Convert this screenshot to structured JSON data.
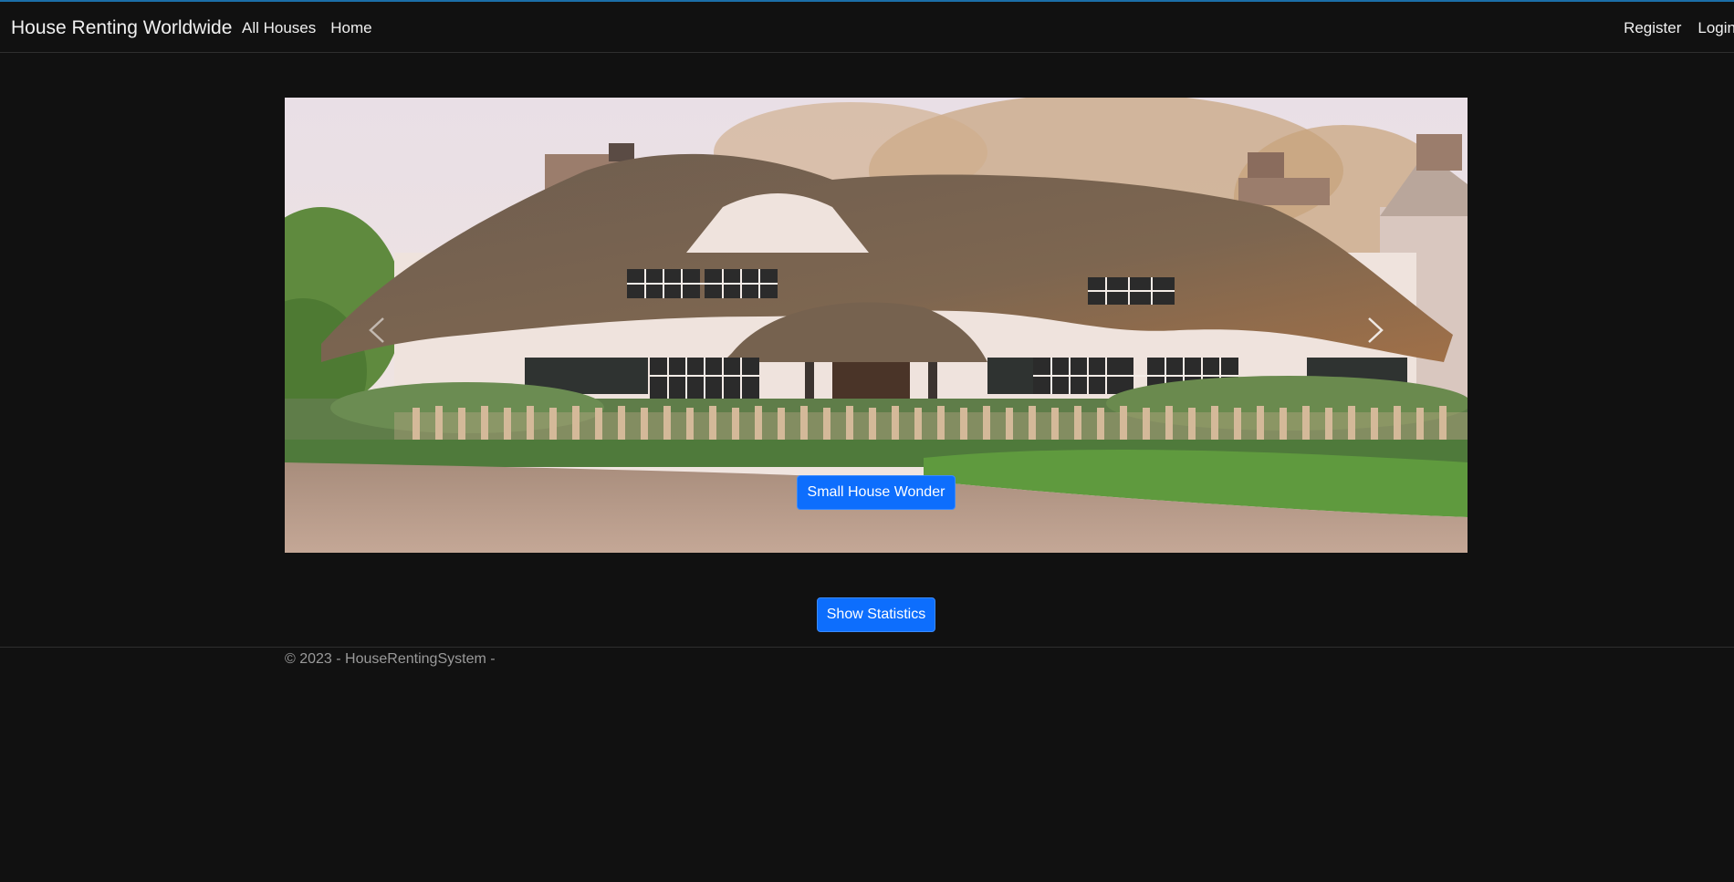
{
  "navbar": {
    "brand": "House Renting Worldwide",
    "left_links": [
      "All Houses",
      "Home"
    ],
    "right_links": [
      "Register",
      "Login"
    ]
  },
  "carousel": {
    "caption_button": "Small House Wonder",
    "prev_icon": "chevron-left-icon",
    "next_icon": "chevron-right-icon"
  },
  "main": {
    "stats_button": "Show Statistics"
  },
  "footer": {
    "text": "© 2023 - HouseRentingSystem -"
  },
  "colors": {
    "background": "#111111",
    "accent": "#0d6efd",
    "top_accent": "#1b6ea8"
  }
}
